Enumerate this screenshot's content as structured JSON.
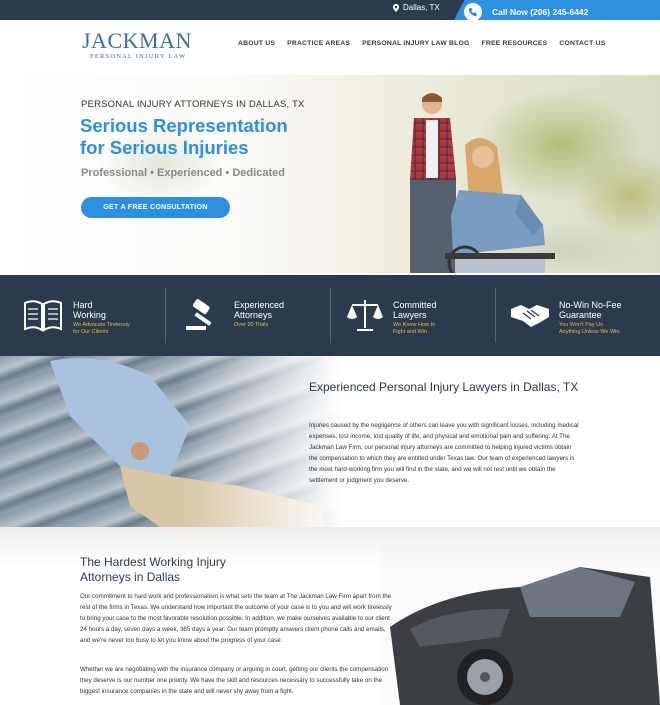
{
  "topbar": {
    "location": "Dallas, TX",
    "call_label": "Call Now (206) 245-6442"
  },
  "header": {
    "logo_name": "JACKMAN",
    "logo_sub": "PERSONAL INJURY LAW",
    "nav": [
      "ABOUT US",
      "PRACTICE AREAS",
      "PERSONAL INJURY LAW BLOG",
      "FREE RESOURCES",
      "CONTACT US"
    ]
  },
  "hero": {
    "eyebrow": "PERSONAL INJURY ATTORNEYS IN DALLAS, TX",
    "headline_line1": "Serious Representation",
    "headline_line2": "for Serious Injuries",
    "tagline": "Professional • Experienced • Dedicated",
    "cta": "GET A FREE CONSULTATION"
  },
  "features": [
    {
      "icon": "book-icon",
      "title1": "Hard",
      "title2": "Working",
      "sub1": "We Advocate Tirelessly",
      "sub2": "for Our Clients"
    },
    {
      "icon": "gavel-icon",
      "title1": "Experienced",
      "title2": "Attorneys",
      "sub1": "Over 20 Trials",
      "sub2": ""
    },
    {
      "icon": "scales-icon",
      "title1": "Committed",
      "title2": "Lawyers",
      "sub1": "We Know How to",
      "sub2": "Fight and Win"
    },
    {
      "icon": "handshake-icon",
      "title1": "No-Win No-Fee",
      "title2": "Guarantee",
      "sub1": "You Won't Pay Us",
      "sub2": "Anything Unless We Win."
    }
  ],
  "section2": {
    "heading": "Experienced Personal Injury Lawyers in Dallas, TX",
    "body": "Injuries caused by the negligence of others can leave you with significant losses, including medical expenses, lost income, lost quality of life, and physical and emotional pain and suffering. At The Jackman Law Firm, our personal injury attorneys are committed to helping injured victims obtain the compensation to which they are entitled under Texas law. Our team of experienced lawyers is the most hard-working firm you will find in the state, and we will not rest until we obtain the settlement or judgment you deserve."
  },
  "section3": {
    "heading_line1": "The Hardest Working Injury",
    "heading_line2": "Attorneys in Dallas",
    "para1": "Our commitment to hard work and professionalism is what sets the team at The Jackman Law Firm apart from the rest of the firms in Texas. We understand how important the outcome of your case is to you and will work tirelessly to bring your case to the most favorable resolution possible. In addition, we make ourselves available to our client 24 hours a day, seven days a week, 365 days a year. Our team promptly answers client phone calls and emails, and we're never too busy to let you know about the progress of your case.",
    "para2": "Whether we are negotiating with the insurance company or arguing in court, getting our clients the compensation they deserve is our number one priority. We have the skill and resources necessary to successfully take on the biggest insurance companies in the state and will never shy away from a fight."
  },
  "colors": {
    "navy": "#2c3a4e",
    "accent_blue": "#2d8fe0",
    "gold": "#e5b84a"
  }
}
